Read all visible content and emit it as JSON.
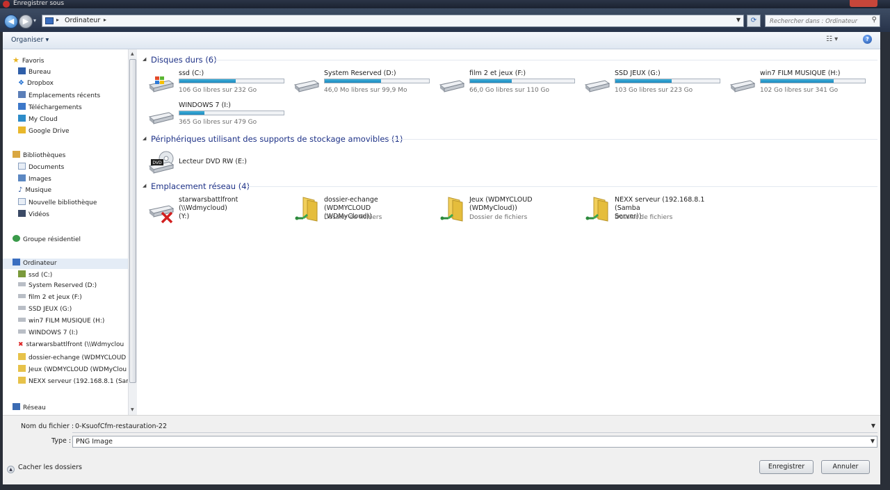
{
  "window": {
    "title": "Enregistrer sous"
  },
  "address": {
    "crumb": "Ordinateur",
    "search_placeholder": "Rechercher dans : Ordinateur"
  },
  "toolbar": {
    "organize_label": "Organiser ▾"
  },
  "nav": {
    "favorites": {
      "label": "Favoris",
      "items": [
        "Bureau",
        "Dropbox",
        "Emplacements récents",
        "Téléchargements",
        "My Cloud",
        "Google Drive"
      ]
    },
    "libraries": {
      "label": "Bibliothèques",
      "items": [
        "Documents",
        "Images",
        "Musique",
        "Nouvelle bibliothèque",
        "Vidéos"
      ]
    },
    "homegroup": {
      "label": "Groupe résidentiel"
    },
    "computer": {
      "label": "Ordinateur",
      "items": [
        "ssd (C:)",
        "System Reserved (D:)",
        "film 2 et jeux (F:)",
        "SSD JEUX (G:)",
        "win7  FILM MUSIQUE (H:)",
        "WINDOWS 7 (I:)",
        "starwarsbattlfront (\\\\Wdmyclou",
        "dossier-echange (WDMYCLOUD",
        "Jeux (WDMYCLOUD (WDMyClou",
        "NEXX serveur (192.168.8.1 (Samb"
      ]
    },
    "network": {
      "label": "Réseau"
    }
  },
  "groups": {
    "hard_drives": {
      "label": "Disques durs (6)"
    },
    "removable": {
      "label": "Périphériques utilisant des supports de stockage amovibles (1)"
    },
    "network": {
      "label": "Emplacement réseau (4)"
    }
  },
  "drives": [
    {
      "name": "ssd (C:)",
      "free": "106 Go libres sur 232 Go",
      "used_fraction": 0.54
    },
    {
      "name": "System Reserved (D:)",
      "free": "46,0 Mo libres sur 99,9 Mo",
      "used_fraction": 0.54
    },
    {
      "name": "film 2 et jeux (F:)",
      "free": "66,0 Go libres sur 110 Go",
      "used_fraction": 0.4
    },
    {
      "name": "SSD JEUX (G:)",
      "free": "103 Go libres sur 223 Go",
      "used_fraction": 0.54
    },
    {
      "name": "win7  FILM MUSIQUE (H:)",
      "free": "102 Go libres sur 341 Go",
      "used_fraction": 0.7
    },
    {
      "name": "WINDOWS 7 (I:)",
      "free": "365 Go libres sur 479 Go",
      "used_fraction": 0.24
    }
  ],
  "dvd": {
    "name": "Lecteur DVD RW (E:)",
    "badge": "DVD"
  },
  "network_locations": [
    {
      "line1": "starwarsbattlfront (\\\\Wdmycloud)",
      "line2": "(Y:)",
      "sub": ""
    },
    {
      "line1": "dossier-echange (WDMYCLOUD",
      "line2": "(WDMyCloud))",
      "sub": "Dossier de fichiers"
    },
    {
      "line1": "Jeux (WDMYCLOUD",
      "line2": "(WDMyCloud))",
      "sub": "Dossier de fichiers"
    },
    {
      "line1": "NEXX serveur (192.168.8.1 (Samba",
      "line2": "Server))",
      "sub": "Dossier de fichiers"
    }
  ],
  "bottom": {
    "filename_label": "Nom du fichier :",
    "filename_value": "0-KsuofCfm-restauration-22",
    "type_label": "Type :",
    "type_value": "PNG Image",
    "hide_folders": "Cacher les dossiers",
    "save": "Enregistrer",
    "cancel": "Annuler"
  }
}
